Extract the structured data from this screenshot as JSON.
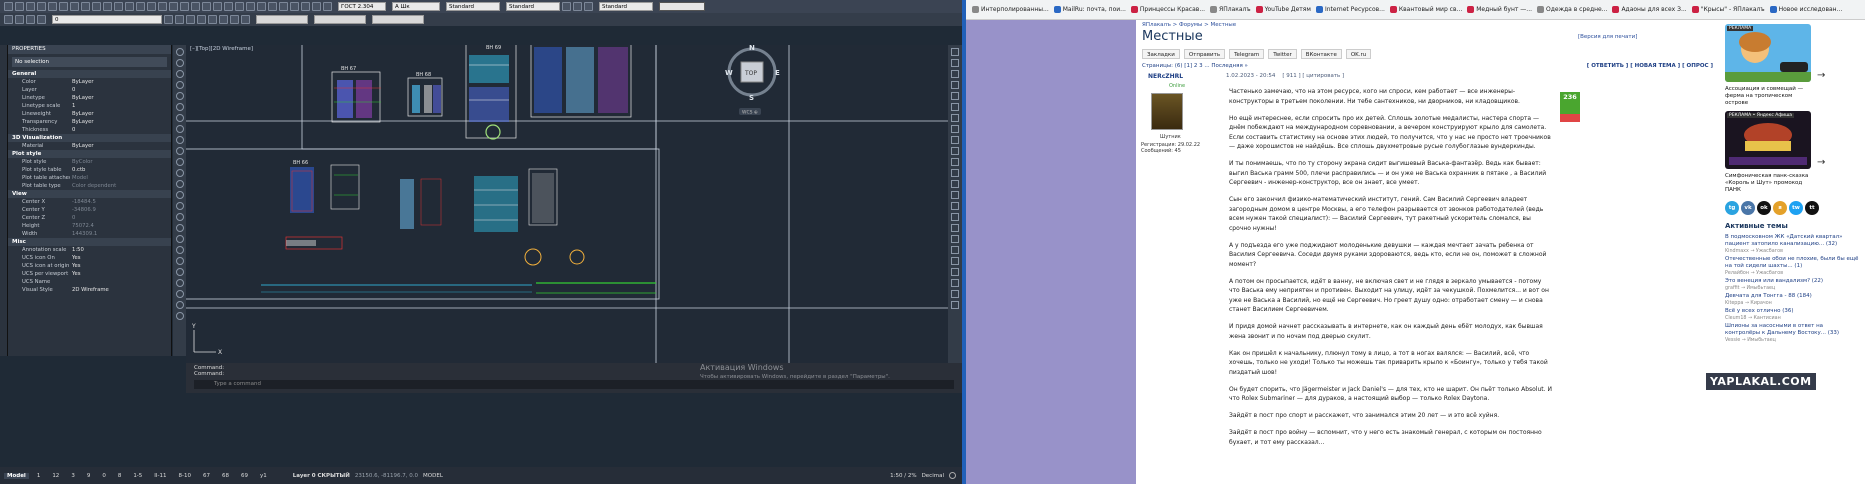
{
  "autocad": {
    "ribbon": {
      "style1": "ГОСТ 2.304",
      "style2": "A Шк",
      "style3": "Standard",
      "style4": "Standard",
      "style5": "Standard",
      "layer_value": "0"
    },
    "properties": {
      "title": "PROPERTIES",
      "selection": "No selection",
      "sections": [
        {
          "name": "General",
          "rows": [
            {
              "k": "Color",
              "v": "ByLayer"
            },
            {
              "k": "Layer",
              "v": "0"
            },
            {
              "k": "Linetype",
              "v": "ByLayer"
            },
            {
              "k": "Linetype scale",
              "v": "1"
            },
            {
              "k": "Lineweight",
              "v": "ByLayer"
            },
            {
              "k": "Transparency",
              "v": "ByLayer"
            },
            {
              "k": "Thickness",
              "v": "0"
            }
          ]
        },
        {
          "name": "3D Visualization",
          "rows": [
            {
              "k": "Material",
              "v": "ByLayer"
            }
          ]
        },
        {
          "name": "Plot style",
          "rows": [
            {
              "k": "Plot style",
              "v": "ByColor",
              "dim": true
            },
            {
              "k": "Plot style table",
              "v": "0.ctb"
            },
            {
              "k": "Plot table attached to",
              "v": "Model",
              "dim": true
            },
            {
              "k": "Plot table type",
              "v": "Color dependent",
              "dim": true
            }
          ]
        },
        {
          "name": "View",
          "rows": [
            {
              "k": "Center X",
              "v": "-18484.5",
              "dim": true
            },
            {
              "k": "Center Y",
              "v": "-34806.9",
              "dim": true
            },
            {
              "k": "Center Z",
              "v": "0",
              "dim": true
            },
            {
              "k": "Height",
              "v": "75072.4",
              "dim": true
            },
            {
              "k": "Width",
              "v": "144309.1",
              "dim": true
            }
          ]
        },
        {
          "name": "Misc",
          "rows": [
            {
              "k": "Annotation scale",
              "v": "1:50"
            },
            {
              "k": "UCS icon On",
              "v": "Yes"
            },
            {
              "k": "UCS icon at origin",
              "v": "Yes"
            },
            {
              "k": "UCS per viewport",
              "v": "Yes"
            },
            {
              "k": "UCS Name",
              "v": ""
            },
            {
              "k": "Visual Style",
              "v": "2D Wireframe"
            }
          ]
        }
      ]
    },
    "canvas": {
      "label": "[–][Top][2D Wireframe]",
      "viewcube_top": "TOP",
      "compass_n": "N",
      "compass_s": "S",
      "compass_e": "E",
      "compass_w": "W",
      "wcs": "WCS ⊕",
      "sheet_labels": [
        "ВН 67",
        "ВН 68",
        "ВН 69",
        "ВН 66"
      ]
    },
    "command": {
      "line1": "Command:",
      "line2": "Command:",
      "placeholder": "Type a command"
    },
    "watermark": {
      "line1": "Активация Windows",
      "line2": "Чтобы активировать Windows, перейдите в раздел \"Параметры\"."
    },
    "status": {
      "model_tab": "Model",
      "tabs": [
        "1",
        "12",
        "3",
        "9",
        "0",
        "8",
        "1-5",
        "II-11",
        "8-10",
        "67",
        "68",
        "69",
        "y1"
      ],
      "layer_info": "Layer 0 СКРЫТЫЙ",
      "coords": "23150.6, -81196.7, 0.0",
      "mode": "MODEL",
      "scale": "1:50 / 2%",
      "units": "Decimal"
    }
  },
  "browser": {
    "bookmarks": [
      "Интерполированны...",
      "MailRu: почта, пои...",
      "Принцессы Красав...",
      "ЯПлакалъ",
      "YouTube Детям",
      "Internet Ресурсов...",
      "Квантовый мир св...",
      "Медный бунт —...",
      "Одежда в средне...",
      "Адаоны для всех З...",
      "\"Крысы\" - ЯПлакалъ",
      "Новое исследован..."
    ],
    "breadcrumb": "ЯПлакалъ > Форумы > Местные",
    "title": "Местные",
    "print_version": "[Версия для печати]",
    "share": [
      "Закладки",
      "Отправить",
      "Telegram",
      "Twitter",
      "ВКонтакте",
      "OK.ru"
    ],
    "pagination": "Страницы: (6) [1] 2 3 ... Последняя »",
    "actions": "[ ОТВЕТИТЬ ] [ НОВАЯ ТЕМА ] [ ОПРОС ]",
    "post": {
      "author": "NERcZHRL",
      "date": "1.02.2023 - 20:54",
      "num": "[ 911 ]",
      "quote": "[ цитировать ]",
      "status": "Online",
      "rank": "Шутник",
      "reg": "Регистрация: 29.02.22",
      "msgs": "Сообщений: 45",
      "score": "236",
      "paragraphs": [
        "Частенько замечаю, что на этом ресурсе, кого ни спроси, кем работает — все инженеры-конструкторы в третьем поколении. Ни тебе сантехников, ни дворников, ни кладовщиков.",
        "Но ещё интереснее, если спросить про их детей. Сплошь золотые медалисты, настера спорта — днём побеждают на международном соревновании, а вечером конструируют крыло для самолета. Если составить статистику на основе этих людей, то получится, что у нас не просто нет троечников — даже хорошистов не найдёшь. Все сплошь двухметровые русые голубоглазые вундеркинды.",
        "И ты понимаешь, что по ту сторону экрана сидит выгишевый Васька-фантазёр. Ведь как бывает: выгил Васька грамм 500, плечи расправились — и он уже не Васька охранник в пятаке , а Василий Сергеевич - инженер-конструктор, все он знает, все умеет.",
        "Сын его закончил физико-математический институт, гений. Сам Василий Сергеевич владеет загородным домом в центре Москвы, а его телефон разрывается от звонков работодателей (ведь всем нужен такой специалист): — Василий Сергеевич, тут ракетный ускоритель сломался, вы срочно нужны!",
        "А у подъезда его уже поджидают молоденькие девушки — каждая мечтает зачать ребенка от Василия Сергеевича. Соседи двумя руками здороваются, ведь кто, если не он, поможет в сложной момент?",
        "А потом он просыпается, идёт в ванну, не включая свет и не глядя в зеркало умывается - потому что Васька ему неприятен и противен. Выходит на улицу, идёт за чекушкой. Похмелится... и вот он уже не Васька а Василий, но ещё не Сергеевич. Но греет душу одно: отработает смену — и снова станет Василием Сергеевичем.",
        "И придя домой начнет рассказывать в интернете, как он каждый день ебёт молодух, как бывшая жена звонит и по ночам под дверью скулит.",
        "Как он пришёл к начальнику, плюнул тому в лицо, а тот в ногах валялся: — Василий, всё, что хочешь, только не уходи! Только ты можешь так приварить крыло к «Боингу», только у тебя такой пиздатый шов!",
        "Он будет спорить, что Jägermeister и Jack Daniel's — для тех, кто не шарит. Он пьёт только Absolut. И что Rolex Submariner — для дураков, а настоящий выбор — только Rolex Daytona.",
        "Зайдёт в пост про спорт и расскажет, что занимался этим 20 лет — и это всё хуйня.",
        "Зайдёт в пост про войну — вспомнит, что у него есть знакомый генерал, с которым он постоянно бухает, и тот ему рассказал..."
      ]
    },
    "sidebar": {
      "ad1_tag": "РЕКЛАМА",
      "ad1_text": "Ассоциация и совмещай — ферма на тропическом острове",
      "ad2_tag": "РЕКЛАМА • Яндекс Афиша",
      "ad2_text": "Симфоническая панк-сказка «Король и Шут» промокод ПАНК",
      "social": [
        "tg",
        "vk",
        "ok",
        "я",
        "tw",
        "tt"
      ],
      "active_title": "Активные темы",
      "topics": [
        {
          "t": "В подмосковном ЖК «Датский квартал» пациент затопило канализацию... (32)",
          "m": "Kindmaxx → Ужасбагов"
        },
        {
          "t": "Отечественные обои не плохие, были бы ещё на той сидели шахты... (1)",
          "m": "Релайбон → Ужасбагов"
        },
        {
          "t": "Это венеция или вандализм? (22)",
          "m": "graffit → Имыбьтаец"
        },
        {
          "t": "Девчата для Тонгга - 88 (184)",
          "m": "Kiteppa → Кирачон"
        },
        {
          "t": "Всё у всех отлично (36)",
          "m": "Cleum18 → Кантисиан"
        },
        {
          "t": "Шпионы за насосными в ответ на контролёры к Дальнему Востоку... (33)",
          "m": "Vessie → Имыбьтаец"
        }
      ]
    },
    "yaplakal_logo": "YAPLAKAL.COM"
  }
}
